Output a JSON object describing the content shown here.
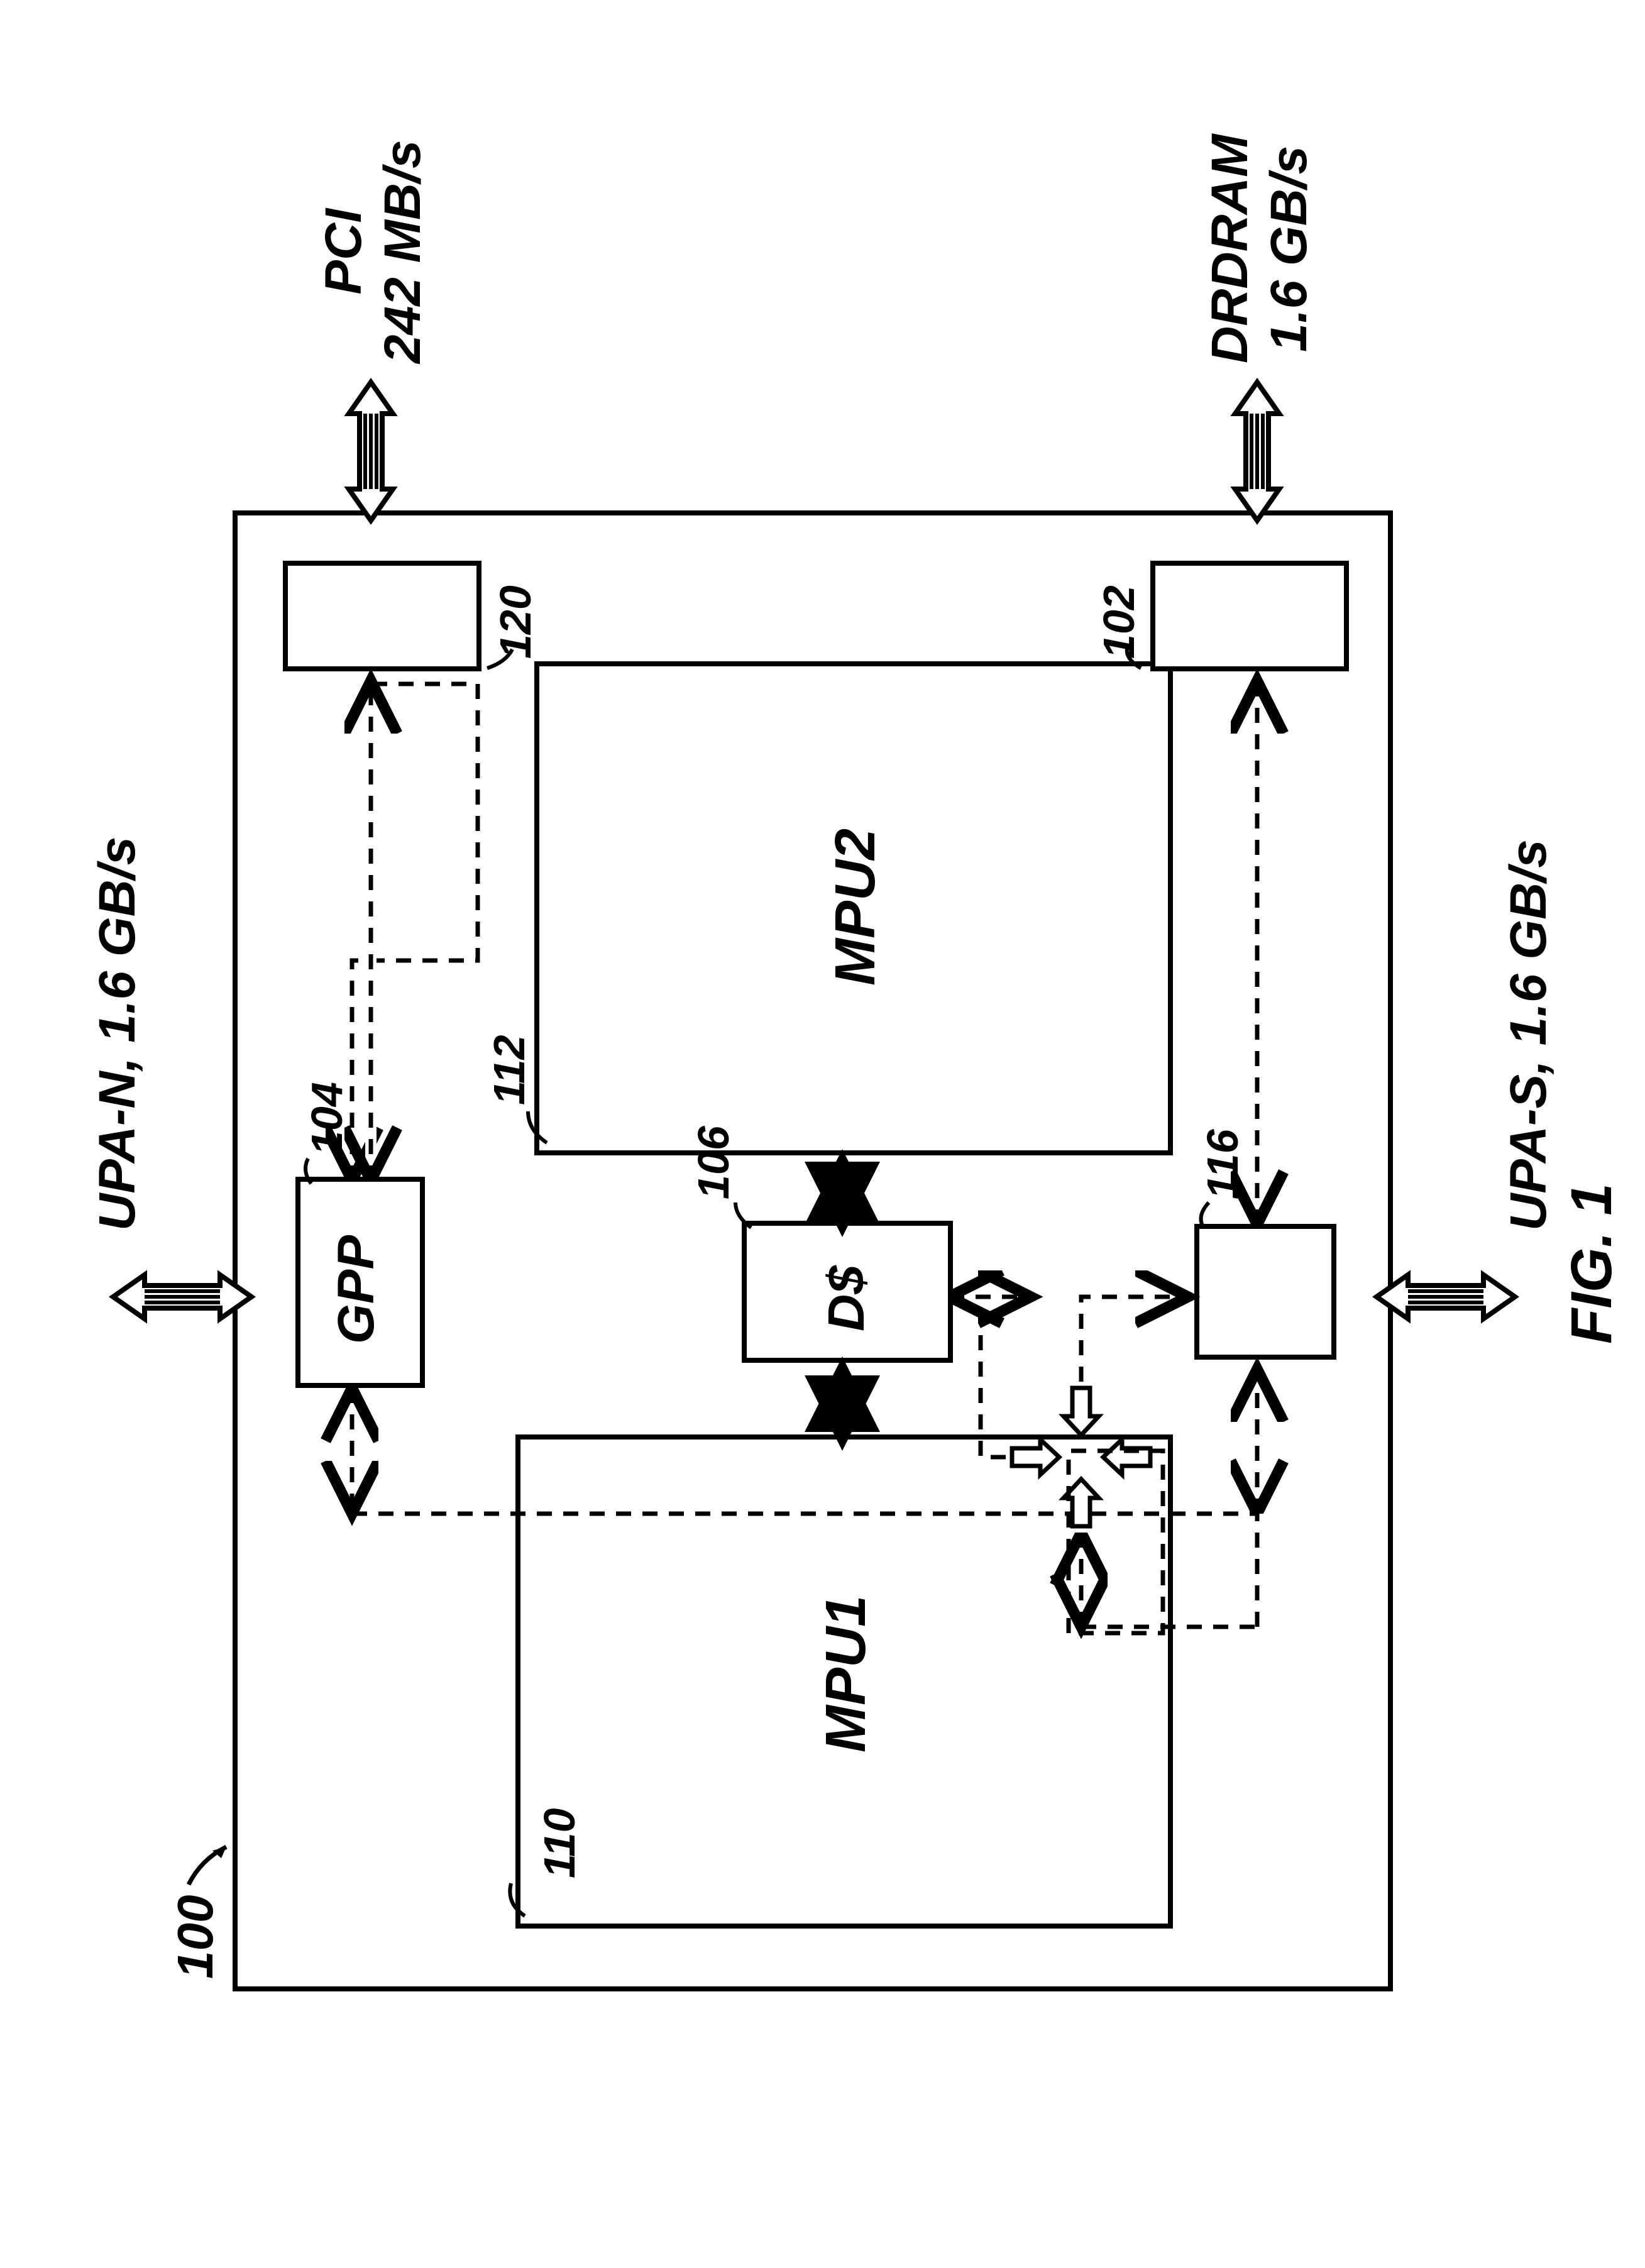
{
  "figure_label": "FIG. 1",
  "chip": {
    "ref": "100"
  },
  "ports": {
    "upa_n": {
      "name": "UPA-N, 1.6 GB/s"
    },
    "upa_s": {
      "name": "UPA-S, 1.6 GB/s"
    },
    "pci": {
      "name": "PCI\n242 MB/s"
    },
    "drdram": {
      "name": "DRDRAM\n1.6 GB/s"
    }
  },
  "blocks": {
    "mpu1": {
      "name": "MPU1",
      "ref": "110"
    },
    "mpu2": {
      "name": "MPU2",
      "ref": "112"
    },
    "gpp": {
      "name": "GPP",
      "ref": "104"
    },
    "dcache": {
      "name": "D$",
      "ref": "106"
    },
    "upa_s_if": {
      "ref": "116"
    },
    "pci_if": {
      "ref": "120"
    },
    "drdram_if": {
      "ref": "102"
    }
  }
}
